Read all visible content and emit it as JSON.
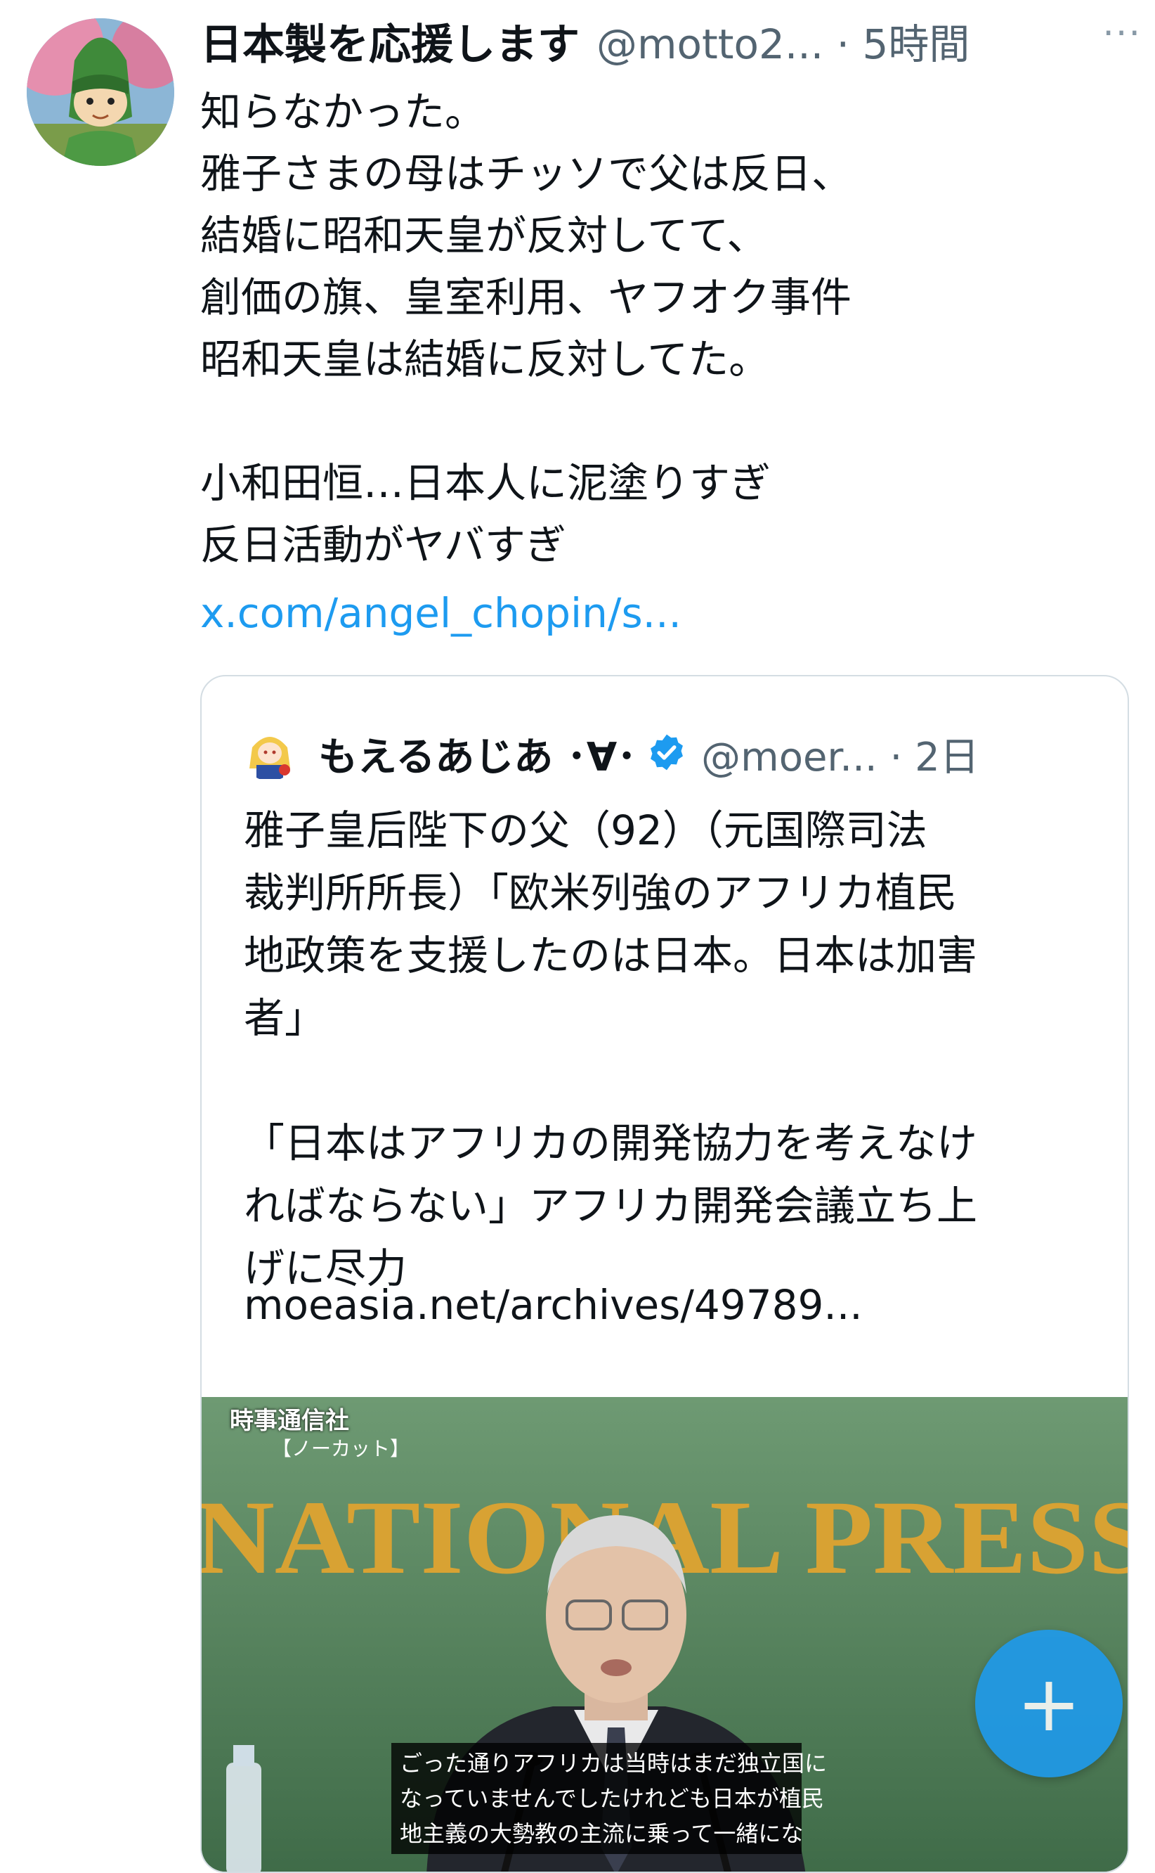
{
  "tweet": {
    "display_name": "日本製を応援します",
    "handle_time": "@motto2... · 5時間",
    "more_icon": "···",
    "lines": "知らなかった。\n雅子さまの母はチッソで父は反日、\n結婚に昭和天皇が反対してて、\n創価の旗、皇室利用、ヤフオク事件\n昭和天皇は結婚に反対してた。\n\n小和田恒…日本人に泥塗りすぎ\n反日活動がヤバすぎ",
    "link": "x.com/angel_chopin/s..."
  },
  "quote": {
    "display_name": "もえるあじあ ･∀･",
    "handle_time": "@moer... · 2日",
    "lines": "雅子皇后陛下の父（92）（元国際司法\n裁判所所長）「欧米列強のアフリカ植民\n地政策を支援したのは日本。日本は加害\n者」\n\n「日本はアフリカの開発協力を考えなけ\nればならない」アフリカ開発会議立ち上\nげに尽力",
    "link": "moeasia.net/archives/49789..."
  },
  "media": {
    "broadcaster": "時事通信社",
    "broadcaster_sub": "【ノーカット】",
    "banner": "NATIONAL PRESS",
    "subtitle": "ごった通りアフリカは当時はまだ独立国に\nなっていませんでしたけれども日本が植民\n地主義の大勢教の主流に乗って一緒にな"
  },
  "fab_label": "+",
  "colors": {
    "link": "#1d9bf0",
    "secondary_text": "#536471",
    "verified": "#1d9bf0"
  }
}
